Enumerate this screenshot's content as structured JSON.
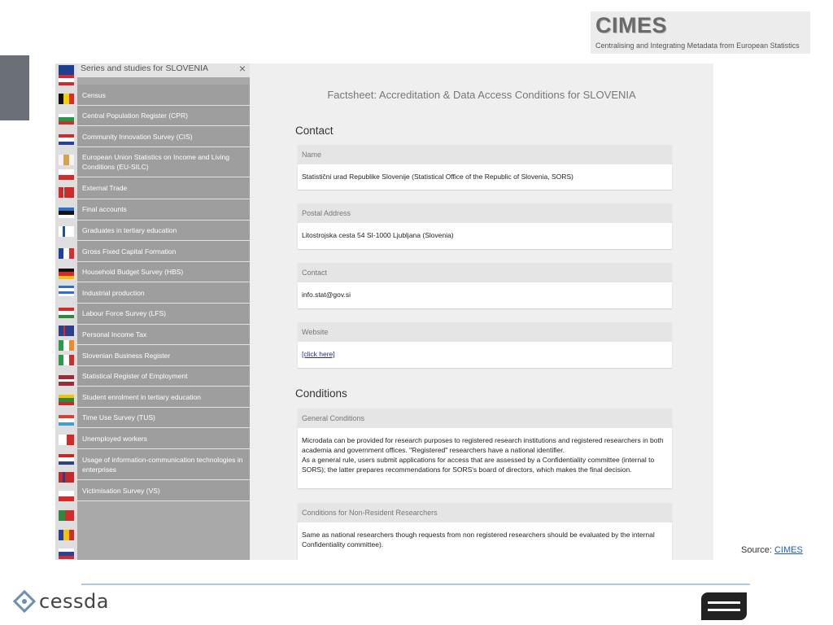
{
  "logo": {
    "title": "CIMES",
    "subtitle": "Centralising and Integrating Metadata from European Statistics"
  },
  "sidebar": {
    "title": "Series and studies for SLOVENIA",
    "close": "×",
    "items": [
      {
        "label": "Census"
      },
      {
        "label": "Central Population Register (CPR)"
      },
      {
        "label": "Community Innovation Survey (CIS)"
      },
      {
        "label": "European Union Statistics on Income and Living Conditions (EU-SILC)"
      },
      {
        "label": "External Trade"
      },
      {
        "label": "Final accounts"
      },
      {
        "label": "Graduates in tertiary education"
      },
      {
        "label": "Gross Fixed Capital Formation"
      },
      {
        "label": "Household Budget Survey (HBS)"
      },
      {
        "label": "Industrial production"
      },
      {
        "label": "Labour Force Survey (LFS)"
      },
      {
        "label": "Personal Income Tax"
      },
      {
        "label": "Slovenian Business Register"
      },
      {
        "label": "Statistical Register of Employment"
      },
      {
        "label": "Student enrolment in tertiary education"
      },
      {
        "label": "Time Use Survey (TUS)"
      },
      {
        "label": "Unemployed workers"
      },
      {
        "label": "Usage of information-communication technologies in enterprises"
      },
      {
        "label": "Victimisation Survey (VS)"
      }
    ]
  },
  "factsheet": {
    "title": "Factsheet: Accreditation & Data Access Conditions for SLOVENIA",
    "contact_heading": "Contact",
    "name_label": "Name",
    "name_value": "Statistični urad Republike Slovenije (Statistical Office of the Republic of Slovenia, SORS)",
    "postal_label": "Postal Address",
    "postal_value": "Litostrojska cesta 54 SI-1000 Ljubljana (Slovenia)",
    "contact_label": "Contact",
    "contact_value": "info.stat@gov.si",
    "website_label": "Website",
    "website_link": "[click here]",
    "conditions_heading": "Conditions",
    "general_label": "General Conditions",
    "general_p1": "Microdata can be provided for research purposes to registered research institutions and registered researchers in both academia and government offices. \"Registered\" researchers have a national identifier.",
    "general_p2": "As a general rule, users submit applications for access that are assessed by a Confidentiality committee (internal to SORS); the latter prepares recommendations for SORS's board of directors, which makes the final decision.",
    "nonres_label": "Conditions for Non-Resident Researchers",
    "nonres_value": "Same as national researchers though requests from non registered researchers should be evaluated by the internal Confidentiality committee)."
  },
  "source": {
    "prefix": "Source: ",
    "link": "CIMES"
  },
  "footer": {
    "cessda": "cessda"
  },
  "colors": {
    "sidebar_item_bg": "#9e9e9e",
    "footer_line": "#b0c9e2",
    "link": "#1f5fbf"
  }
}
